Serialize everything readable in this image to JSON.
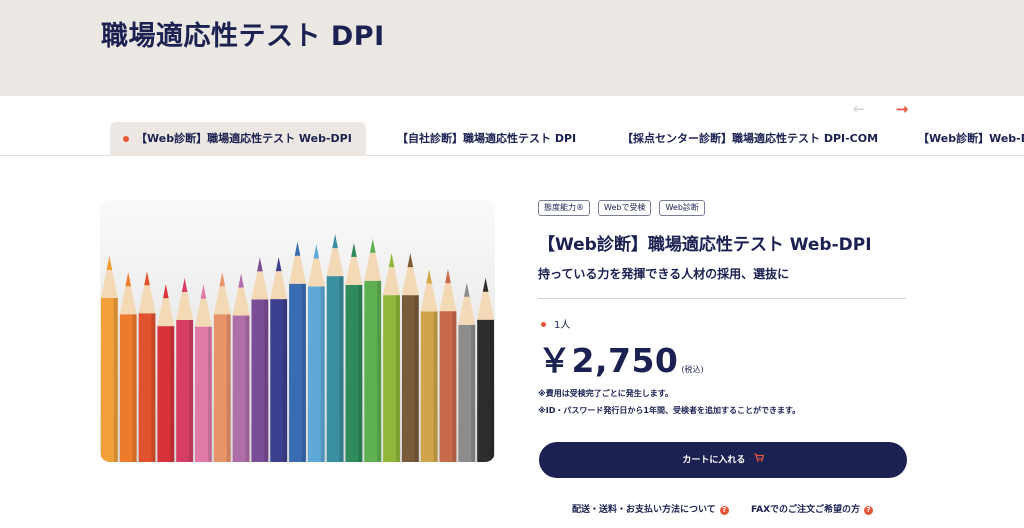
{
  "header": {
    "title": "職場適応性テスト DPI"
  },
  "carousel": {
    "prev_icon": "arrow-left-icon",
    "next_icon": "arrow-right-icon",
    "prev_symbol": "←",
    "next_symbol": "→"
  },
  "tabs": [
    {
      "label": "【Web診断】職場適応性テスト Web-DPI",
      "active": true
    },
    {
      "label": "【自社診断】職場適応性テスト DPI",
      "active": false
    },
    {
      "label": "【採点センター診断】職場適応性テスト DPI-COM",
      "active": false
    },
    {
      "label": "【Web診断】Web-DPI",
      "active": false
    }
  ],
  "product": {
    "image": "colored-pencils-photo",
    "tags": [
      "態度能力®",
      "Webで受検",
      "Web診断"
    ],
    "name": "【Web診断】職場適応性テスト Web-DPI",
    "catch_copy": "持っている力を発揮できる人材の採用、選抜に",
    "unit": "1人",
    "price": "￥2,750",
    "tax_note": "(税込)",
    "notes": [
      "※費用は受検完了ごとに発生します。",
      "※ID・パスワード発行日から1年間、受検者を追加することができます。"
    ],
    "cart_label": "カートに入れる",
    "cart_icon": "cart-icon"
  },
  "links": {
    "shipping": "配送・送料・お支払い方法について",
    "fax": "FAXでのご注文ご希望の方",
    "help_icon": "help-icon",
    "help_symbol": "?"
  },
  "colors": {
    "navy": "#1b2150",
    "accent": "#e8563a",
    "band": "#ebe7e3"
  }
}
